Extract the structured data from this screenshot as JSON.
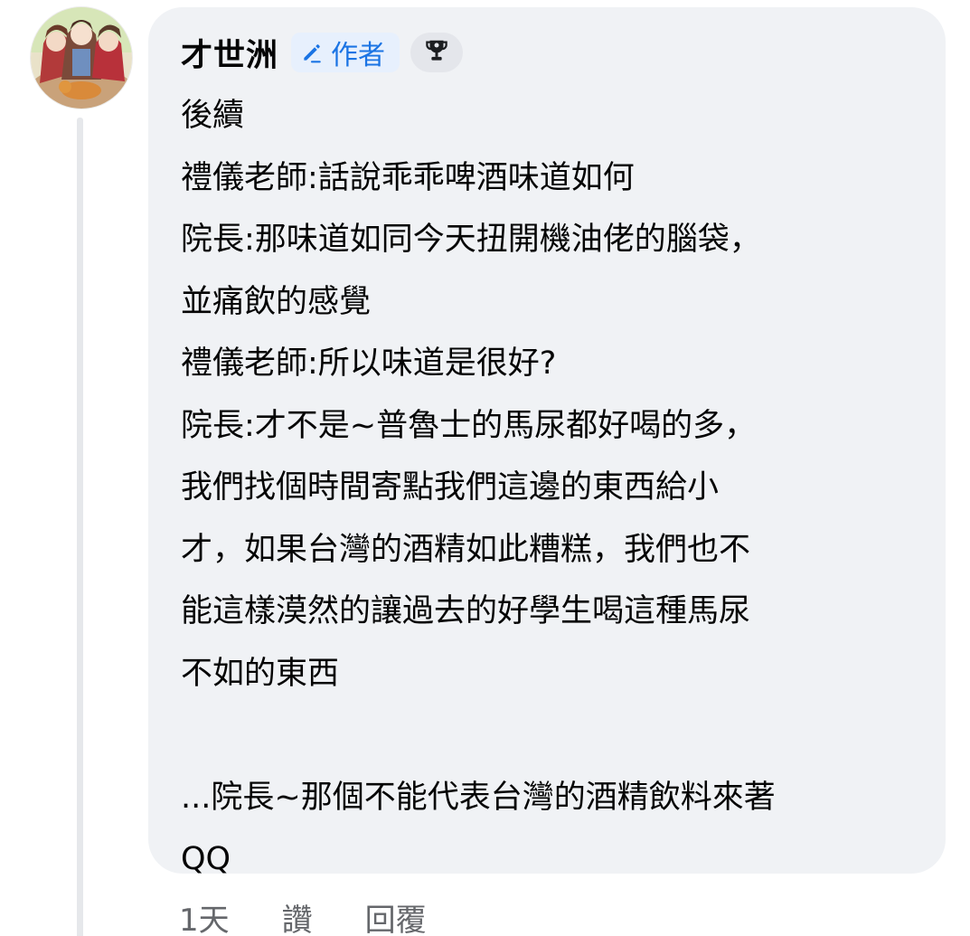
{
  "comment": {
    "author": "才世洲",
    "author_badge": "作者",
    "badge_icon": "pen-icon",
    "extra_badge_icon": "trophy-icon",
    "body_lines": [
      "後續",
      "禮儀老師:話說乖乖啤酒味道如何",
      "院長:那味道如同今天扭開機油佬的腦袋，",
      "並痛飲的感覺",
      "禮儀老師:所以味道是很好?",
      "院長:才不是~普魯士的馬尿都好喝的多，",
      "我們找個時間寄點我們這邊的東西給小",
      "才，如果台灣的酒精如此糟糕，我們也不",
      "能這樣漠然的讓過去的好學生喝這種馬尿",
      "不如的東西",
      "",
      "...院長~那個不能代表台灣的酒精飲料來著",
      "QQ"
    ]
  },
  "actions": {
    "time": "1天",
    "like": "讚",
    "reply": "回覆"
  },
  "colors": {
    "bubble_bg": "#f0f2f5",
    "text": "#050505",
    "secondary_text": "#65676b",
    "badge_bg": "#e7f0fd",
    "badge_text": "#1b74e4"
  }
}
